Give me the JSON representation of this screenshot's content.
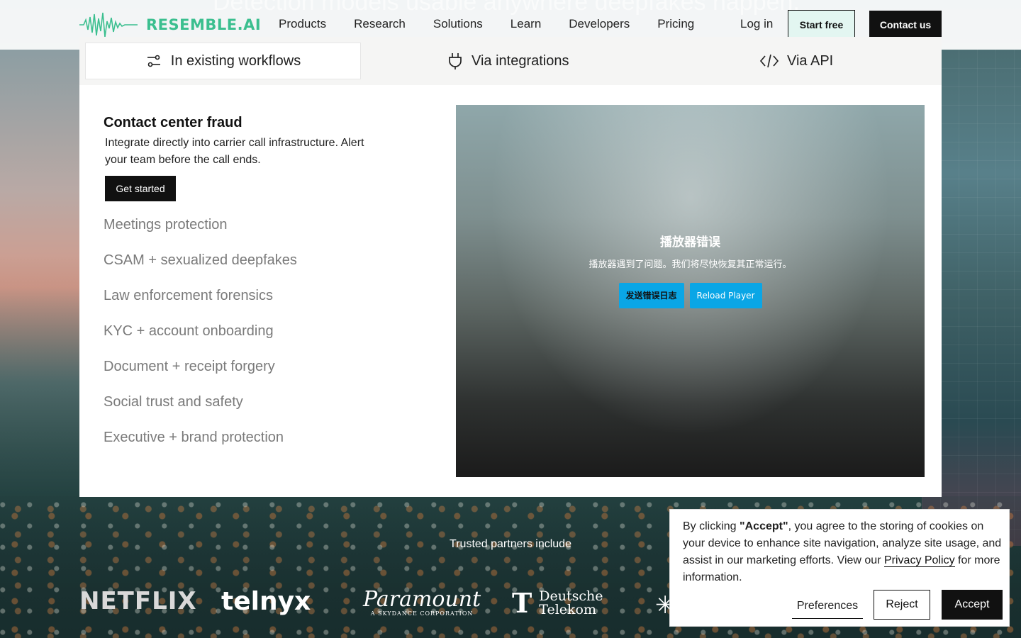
{
  "header": {
    "hero_partial_text": "Detection models usable anywhere deepfakes happen.",
    "logo_text": "RESEMBLE.AI",
    "nav": [
      "Products",
      "Research",
      "Solutions",
      "Learn",
      "Developers",
      "Pricing"
    ],
    "login": "Log in",
    "start_free": "Start free",
    "contact": "Contact us"
  },
  "tabs": [
    {
      "label": "In existing workflows",
      "icon": "workflow-icon",
      "active": true
    },
    {
      "label": "Via integrations",
      "icon": "plug-icon",
      "active": false
    },
    {
      "label": "Via API",
      "icon": "code-icon",
      "active": false
    }
  ],
  "content": {
    "title": "Contact center fraud",
    "description": "Integrate directly into carrier call infrastructure.  Alert your team before the call ends.",
    "cta": "Get started",
    "use_cases": [
      "Meetings protection",
      "CSAM + sexualized deepfakes",
      "Law enforcement forensics",
      "KYC + account onboarding",
      "Document + receipt forgery",
      "Social trust and safety",
      "Executive + brand protection"
    ]
  },
  "player": {
    "error_title": "播放器错误",
    "error_message": "播放器遇到了问题。我们将尽快恢复其正常运行。",
    "send_log": "发送错误日志",
    "reload": "Reload Player"
  },
  "partners": {
    "label": "Trusted partners include",
    "netflix": "NETFLIX",
    "telnyx": "telnyx",
    "paramount": "Paramount",
    "paramount_sub": "A SKYDANCE CORPORATION",
    "dt_line1": "Deutsche",
    "dt_line2": "Telekom"
  },
  "cookie": {
    "prefix": "By clicking ",
    "accept_quote": "\"Accept\"",
    "body": ", you agree to the storing of cookies on your device to enhance site navigation, analyze site usage, and assist in our marketing efforts. View our ",
    "privacy": "Privacy Policy",
    "suffix": " for more information.",
    "preferences": "Preferences",
    "reject": "Reject",
    "accept": "Accept"
  },
  "colors": {
    "brand": "#3bbf8f",
    "player_button": "#0aa6e6",
    "dark": "#111111"
  }
}
